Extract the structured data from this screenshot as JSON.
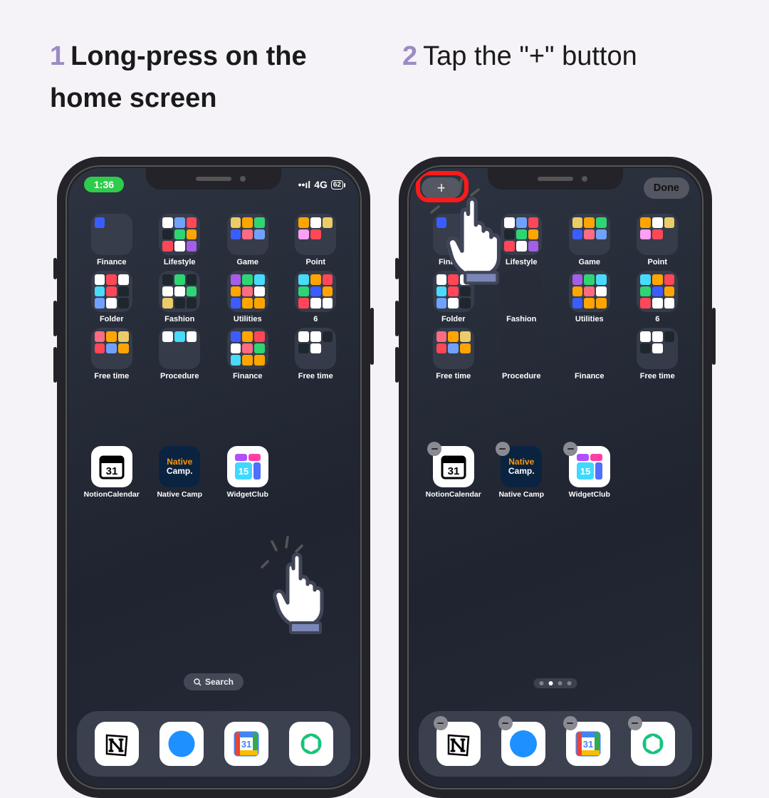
{
  "instructions": {
    "step1_num": "1",
    "step1_text": "Long-press on the home screen",
    "step2_num": "2",
    "step2_text": "Tap the \"+\" button"
  },
  "status": {
    "time": "1:36",
    "network": "4G",
    "signal": "••ıl",
    "battery": "62"
  },
  "edit": {
    "plus": "+",
    "done": "Done"
  },
  "folders": {
    "row1": [
      "Finance",
      "Lifestyle",
      "Game",
      "Point"
    ],
    "row2": [
      "Folder",
      "Fashion",
      "Utilities",
      "6"
    ],
    "row3": [
      "Free time",
      "Procedure",
      "Finance",
      "Free time"
    ]
  },
  "apps": {
    "notioncal": "NotionCalendar",
    "nativecamp": "Native Camp",
    "widgetclub": "WidgetClub",
    "calendar_day": "31"
  },
  "search": {
    "label": "Search"
  },
  "nativecamp_text": {
    "l1": "Native",
    "l2": "Camp."
  }
}
